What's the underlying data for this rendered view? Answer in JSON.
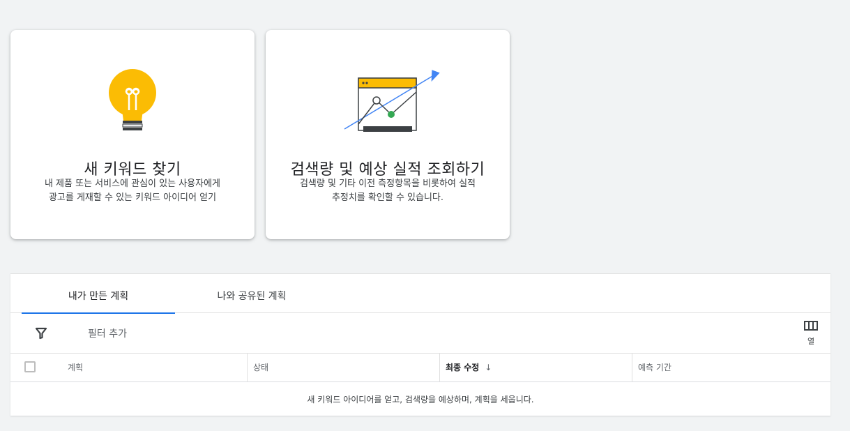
{
  "cards": {
    "discover": {
      "title": "새 키워드 찾기",
      "desc_line1": "내 제품 또는 서비스에 관심이 있는 사용자에게",
      "desc_line2": "광고를 게재할 수 있는 키워드 아이디어 얻기",
      "icon": "lightbulb-icon"
    },
    "forecast": {
      "title": "검색량 및 예상 실적 조회하기",
      "desc_line1": "검색량 및 기타 이전 측정항목을 비롯하여 실적",
      "desc_line2": "추정치를 확인할 수 있습니다.",
      "icon": "trend-chart-icon"
    }
  },
  "tabs": [
    {
      "label": "내가 만든 계획",
      "selected": true
    },
    {
      "label": "나와 공유된 계획",
      "selected": false
    }
  ],
  "filter": {
    "icon": "filter-icon",
    "add_label": "필터 추가"
  },
  "columns_button": {
    "icon": "columns-icon",
    "label": "열"
  },
  "table": {
    "headers": {
      "plan": "계획",
      "status": "상태",
      "last_modified": "최종 수정",
      "forecast_period": "예측 기간"
    },
    "sort_icon": "arrow-down-icon",
    "empty_message": "새 키워드 아이디어를 얻고, 검색량을 예상하며, 계획을 세웁니다."
  },
  "colors": {
    "accent": "#1a73e8",
    "bulb_yellow": "#fbbc04",
    "green_dot": "#34a853",
    "background": "#f1f3f4"
  }
}
